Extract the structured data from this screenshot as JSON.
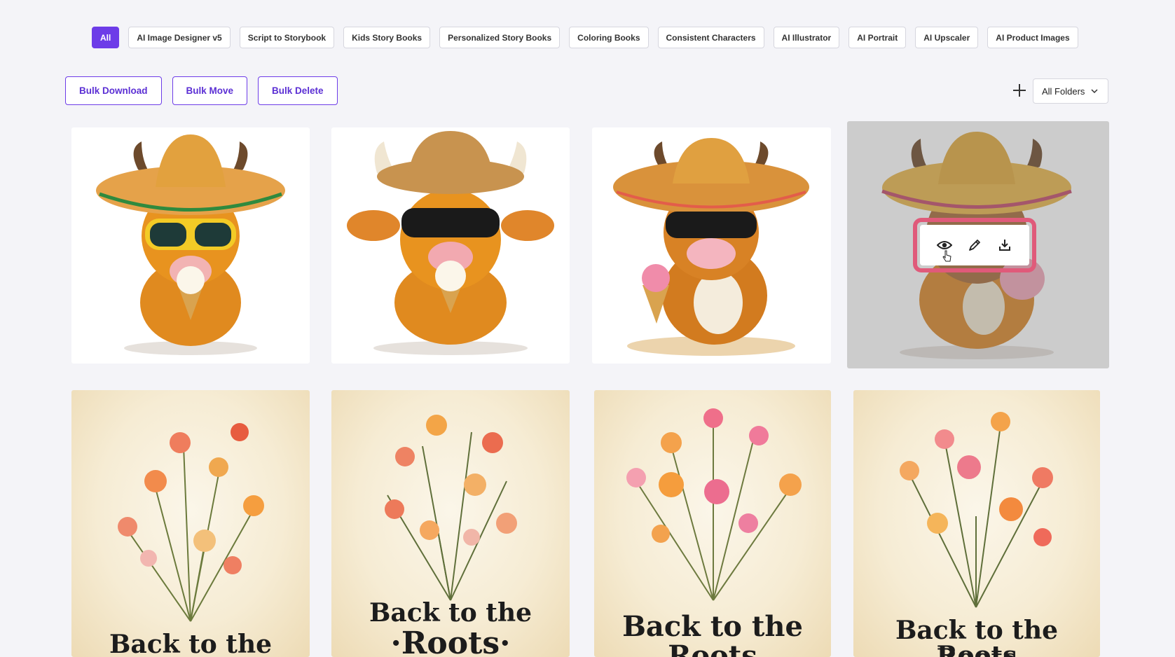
{
  "filters": [
    "All",
    "AI Image Designer v5",
    "Script to Storybook",
    "Kids Story Books",
    "Personalized Story Books",
    "Coloring Books",
    "Consistent Characters",
    "AI Illustrator",
    "AI Portrait",
    "AI Upscaler",
    "AI Product Images"
  ],
  "active_filter": "All",
  "actions": {
    "bulk_download": "Bulk Download",
    "bulk_move": "Bulk Move",
    "bulk_delete": "Bulk Delete"
  },
  "folder_select": {
    "value": "All Folders"
  },
  "gallery": {
    "cow_cards": [
      {
        "subject": "highland-cow-sombrero-ice-cream"
      },
      {
        "subject": "cow-sunglasses-ice-cream"
      },
      {
        "subject": "cow-sombrero-pink-ice-cream"
      },
      {
        "subject": "cow-sombrero-hovered"
      }
    ],
    "flower_cards": [
      {
        "caption_line1": "Back to the Roots",
        "caption_line2": ""
      },
      {
        "caption_line1": "Back to the",
        "caption_line2": "·Roots·"
      },
      {
        "caption_line1": "Back to the",
        "caption_line2": "Roots"
      },
      {
        "caption_line1": "Back to the Roots",
        "caption_line2": "Roots"
      }
    ]
  },
  "hover_toolbar": {
    "icons": [
      "eye-icon",
      "edit-pencil-icon",
      "download-icon"
    ]
  },
  "colors": {
    "accent": "#6d3ce8",
    "hover_highlight": "#e05a7a",
    "background": "#f4f4f8"
  }
}
